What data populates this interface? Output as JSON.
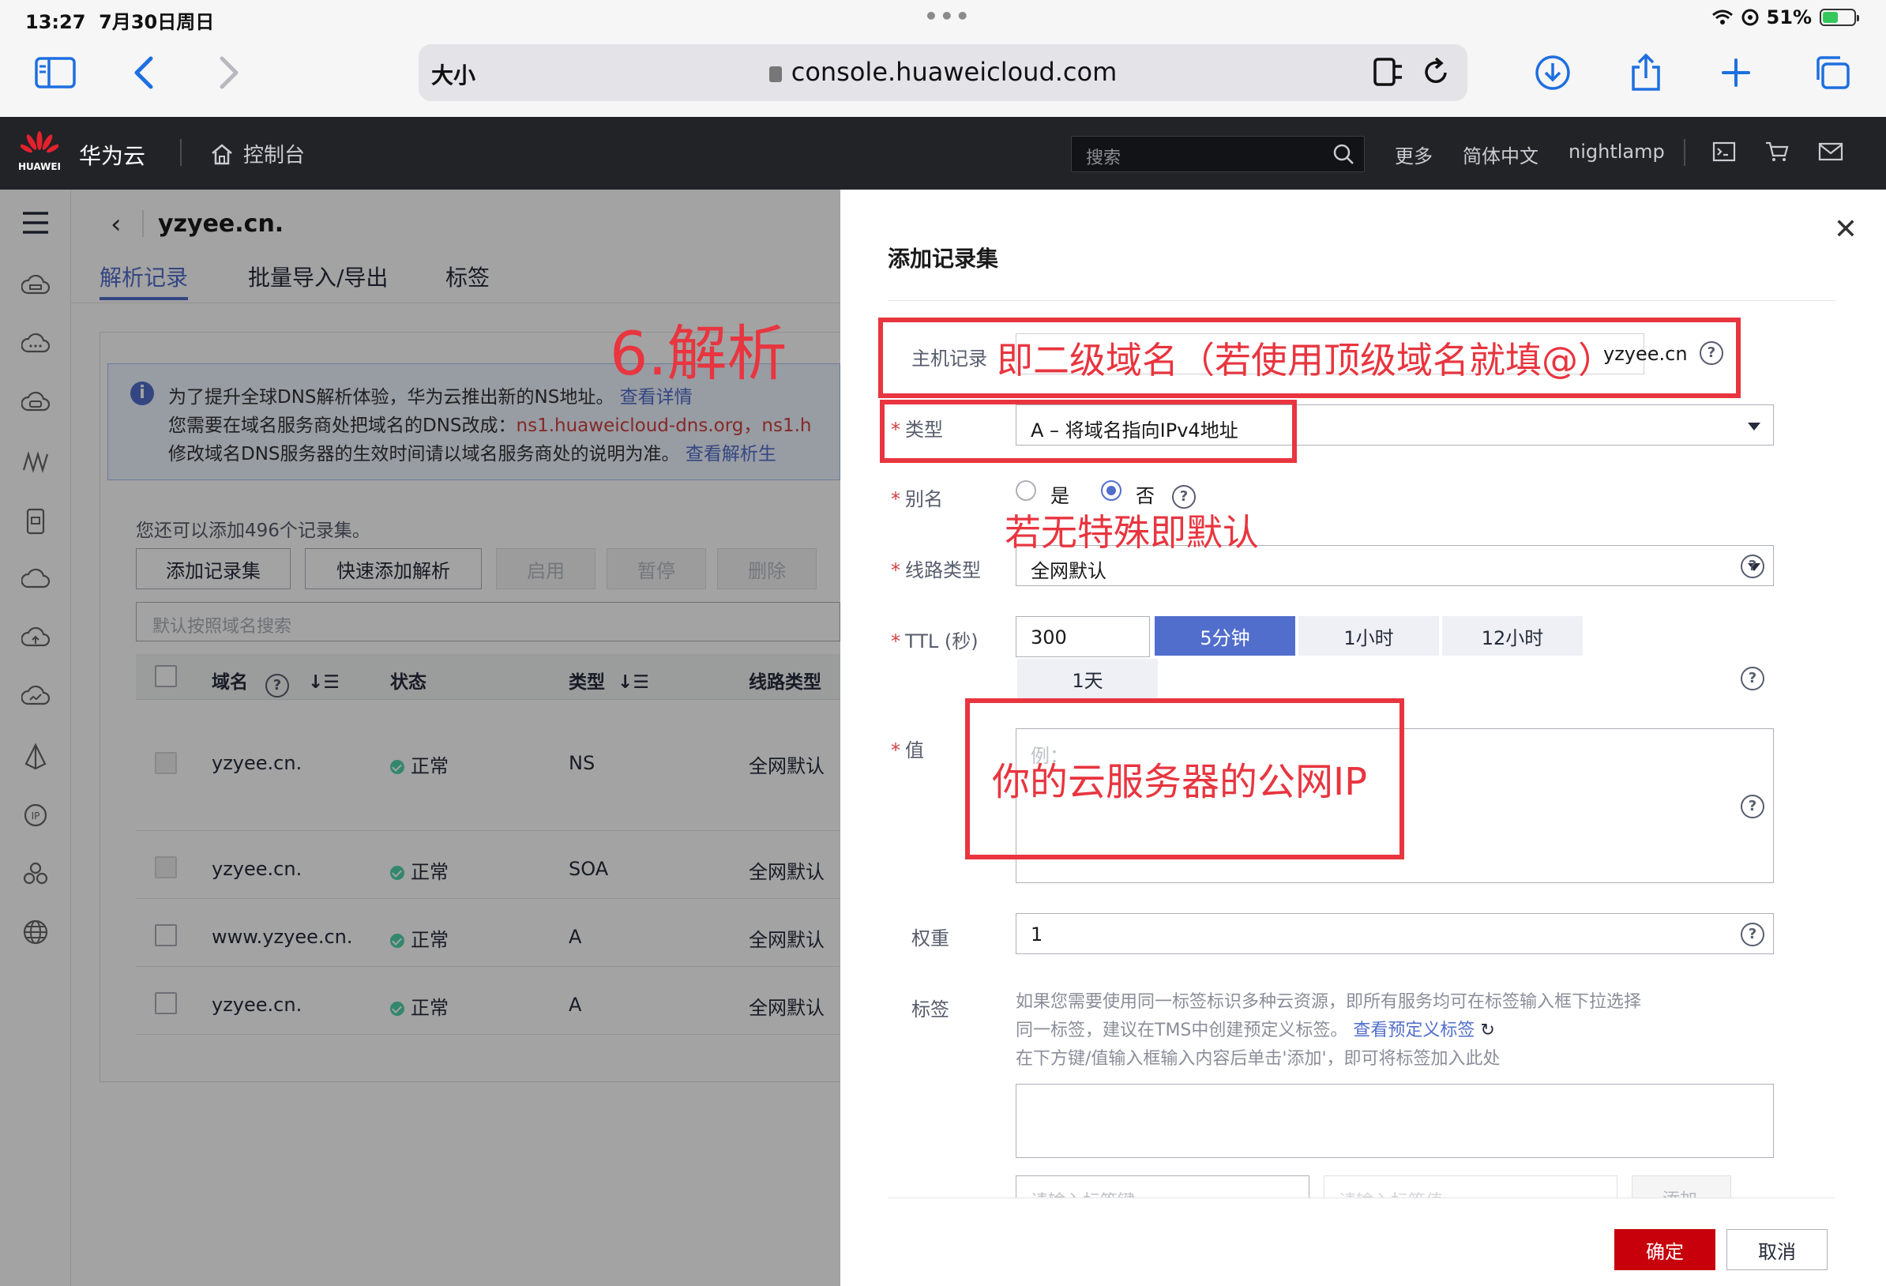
{
  "status_bar": {
    "time": "13:27",
    "date": "7月30日周日",
    "battery": "51%",
    "battery_level": 0.51
  },
  "browser": {
    "text_size": "大小",
    "url": "console.huaweicloud.com"
  },
  "topnav": {
    "logo_text": "HUAWEI",
    "brand": "华为云",
    "console": "控制台",
    "search_placeholder": "搜索",
    "more": "更多",
    "language": "简体中文",
    "user": "nightlamp"
  },
  "page": {
    "domain": "yzyee.cn.",
    "tabs": [
      "解析记录",
      "批量导入/导出",
      "标签"
    ],
    "notice": {
      "line1": "为了提升全球DNS解析体验，华为云推出新的NS地址。",
      "line1_link": "查看详情",
      "line2": "您需要在域名服务商处把域名的DNS改成：",
      "line2_ns": "ns1.huaweicloud-dns.org，ns1.h",
      "line3": "修改域名DNS服务器的生效时间请以域名服务商处的说明为准。",
      "line3_link": "查看解析生"
    },
    "remaining": "您还可以添加496个记录集。",
    "buttons": {
      "add": "添加记录集",
      "quick": "快速添加解析",
      "enable": "启用",
      "pause": "暂停",
      "delete": "删除"
    },
    "search_placeholder": "默认按照域名搜索",
    "table": {
      "headers": {
        "domain": "域名",
        "status": "状态",
        "type": "类型",
        "line": "线路类型"
      },
      "rows": [
        {
          "domain": "yzyee.cn.",
          "status": "正常",
          "type": "NS",
          "line": "全网默认"
        },
        {
          "domain": "yzyee.cn.",
          "status": "正常",
          "type": "SOA",
          "line": "全网默认"
        },
        {
          "domain": "www.yzyee.cn.",
          "status": "正常",
          "type": "A",
          "line": "全网默认"
        },
        {
          "domain": "yzyee.cn.",
          "status": "正常",
          "type": "A",
          "line": "全网默认"
        }
      ]
    }
  },
  "drawer": {
    "title": "添加记录集",
    "host_label": "主机记录",
    "host_suffix": "yzyee.cn",
    "type_label": "类型",
    "type_value": "A – 将域名指向IPv4地址",
    "alias_label": "别名",
    "alias_yes": "是",
    "alias_no": "否",
    "line_label": "线路类型",
    "line_value": "全网默认",
    "ttl_label": "TTL (秒)",
    "ttl_value": "300",
    "ttl_options": [
      "5分钟",
      "1小时",
      "12小时",
      "1天"
    ],
    "value_label": "值",
    "value_placeholder": "例：",
    "weight_label": "权重",
    "weight_value": "1",
    "tag_label": "标签",
    "tag_desc1": "如果您需要使用同一标签标识多种云资源，即所有服务均可在标签输入框下拉选择",
    "tag_desc2": "同一标签，建议在TMS中创建预定义标签。",
    "tag_desc2_link": "查看预定义标签",
    "tag_desc3": "在下方键/值输入框输入内容后单击'添加'，即可将标签加入此处",
    "tag_key_placeholder": "请输入标签键",
    "tag_value_placeholder": "请输入标签值",
    "tag_add": "添加",
    "ok": "确定",
    "cancel": "取消"
  },
  "annotations": {
    "step": "6.解析",
    "host_hint": "即二级域名（若使用顶级域名就填@）",
    "alias_hint": "若无特殊即默认",
    "value_hint": "你的云服务器的公网IP"
  }
}
